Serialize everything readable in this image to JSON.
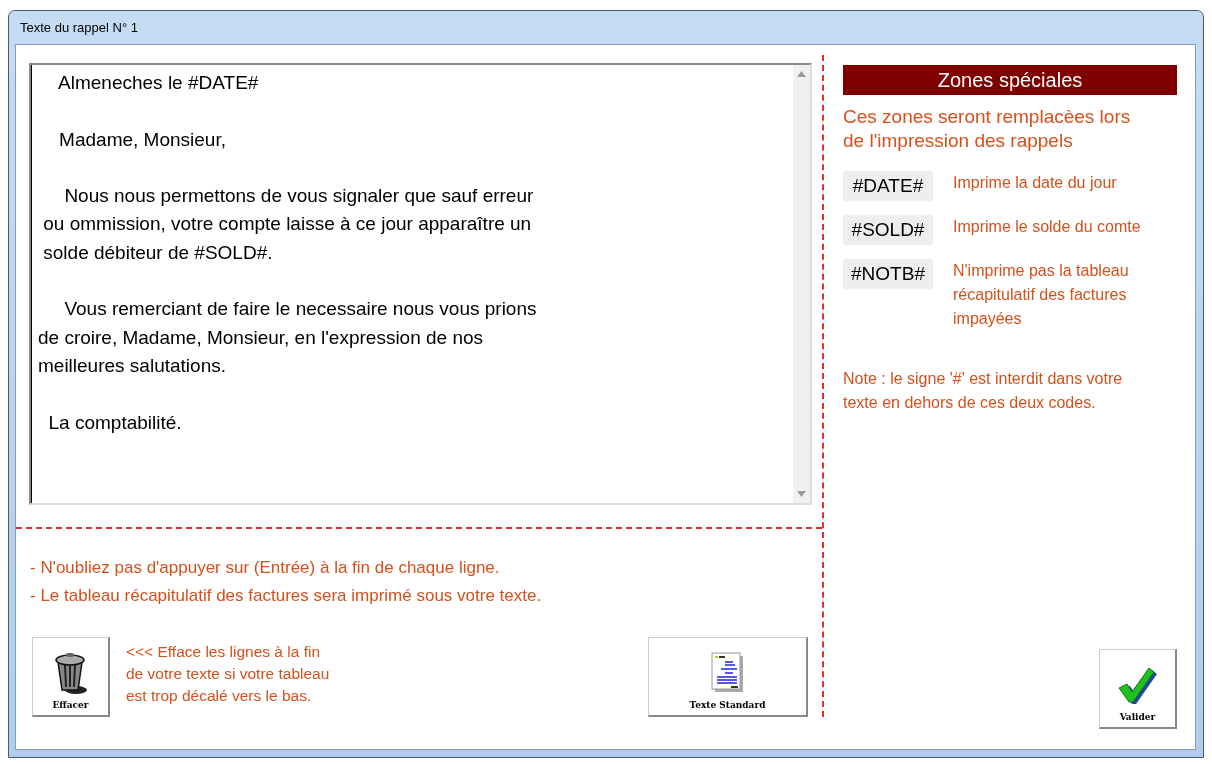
{
  "window": {
    "title": "Texte du rappel N° 1"
  },
  "letter": {
    "paragraphs": [
      [
        "    Almeneches le #DATE#"
      ],
      [
        "    Madame, Monsieur,"
      ],
      [
        "     Nous nous permettons de vous signaler que sauf erreur",
        " ou ommission, votre compte laisse à ce jour apparaître un",
        " solde débiteur de #SOLD#."
      ],
      [
        "     Vous remerciant de faire le necessaire nous vous prions",
        "de croire, Madame, Monsieur, en l'expression de nos",
        "meilleures salutations."
      ],
      [
        "  La comptabilité."
      ]
    ]
  },
  "instructions": [
    "- N'oubliez pas d'appuyer sur (Entrée) à la fin de chaque ligne.",
    "- Le tableau récapitulatif des factures sera imprimé sous votre texte."
  ],
  "clear_button": {
    "label": "Effacer"
  },
  "clear_hint": "<<< Efface les lignes à la fin\nde votre texte si votre tableau\nest trop décalé vers le bas.",
  "standard_button": {
    "label": "Texte Standard"
  },
  "special_zones": {
    "title": "Zones spéciales",
    "intro": "Ces zones seront remplacèes lors\nde l'impression des rappels",
    "codes": [
      {
        "code": "#DATE#",
        "description": "Imprime la date du jour"
      },
      {
        "code": "#SOLD#",
        "description": "Imprime le solde du comte"
      },
      {
        "code": "#NOTB#",
        "description": "N'imprime pas la tableau\nrécapitulatif des factures\nimpayées"
      }
    ],
    "note": "Note : le signe '#' est interdit dans votre\ntexte en dehors de ces deux codes."
  },
  "validate_button": {
    "label": "Valider"
  }
}
